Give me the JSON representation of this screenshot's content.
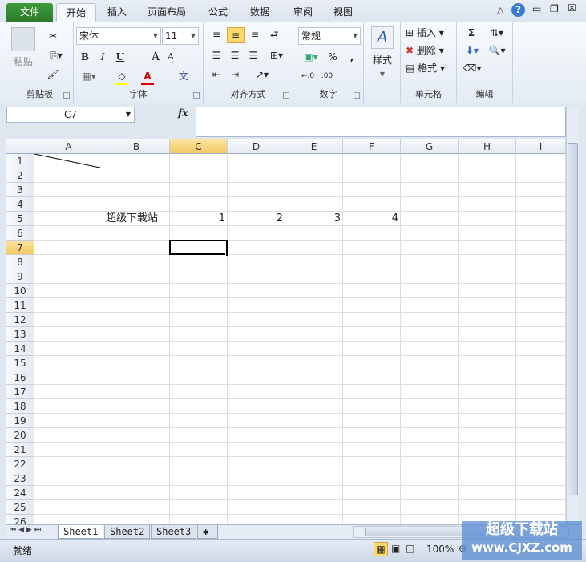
{
  "tabs": [
    "文件",
    "开始",
    "插入",
    "页面布局",
    "公式",
    "数据",
    "审阅",
    "视图"
  ],
  "ribbon": {
    "clipboard": {
      "paste": "粘贴",
      "label": "剪贴板"
    },
    "font": {
      "name": "宋体",
      "size": "11",
      "bold": "B",
      "italic": "I",
      "underline": "U",
      "grow": "A",
      "shrink": "A",
      "color": "A",
      "phonetic": "文",
      "label": "字体"
    },
    "alignment": {
      "label": "对齐方式"
    },
    "number": {
      "format": "常规",
      "percent": "%",
      "comma": ",",
      "inc": "←.0",
      "dec": ".00",
      "label": "数字"
    },
    "styles": {
      "label": "样式"
    },
    "cells": {
      "insert": "插入",
      "delete": "删除",
      "format": "格式",
      "label": "单元格"
    },
    "editing": {
      "sum": "Σ",
      "label": "编辑"
    }
  },
  "namebox": "C7",
  "fx": "fx",
  "columns": [
    "A",
    "B",
    "C",
    "D",
    "E",
    "F",
    "G",
    "H",
    "I"
  ],
  "selected_col": "C",
  "selected_row": 7,
  "cells": [
    {
      "ref": "B5",
      "value": "超级下载站"
    },
    {
      "ref": "C5",
      "value": "1"
    },
    {
      "ref": "D5",
      "value": "2"
    },
    {
      "ref": "E5",
      "value": "3"
    },
    {
      "ref": "F5",
      "value": "4"
    }
  ],
  "sheets": [
    "Sheet1",
    "Sheet2",
    "Sheet3"
  ],
  "status": "就绪",
  "zoom": "100%",
  "watermark": "超级下载站 www.CJXZ.com"
}
